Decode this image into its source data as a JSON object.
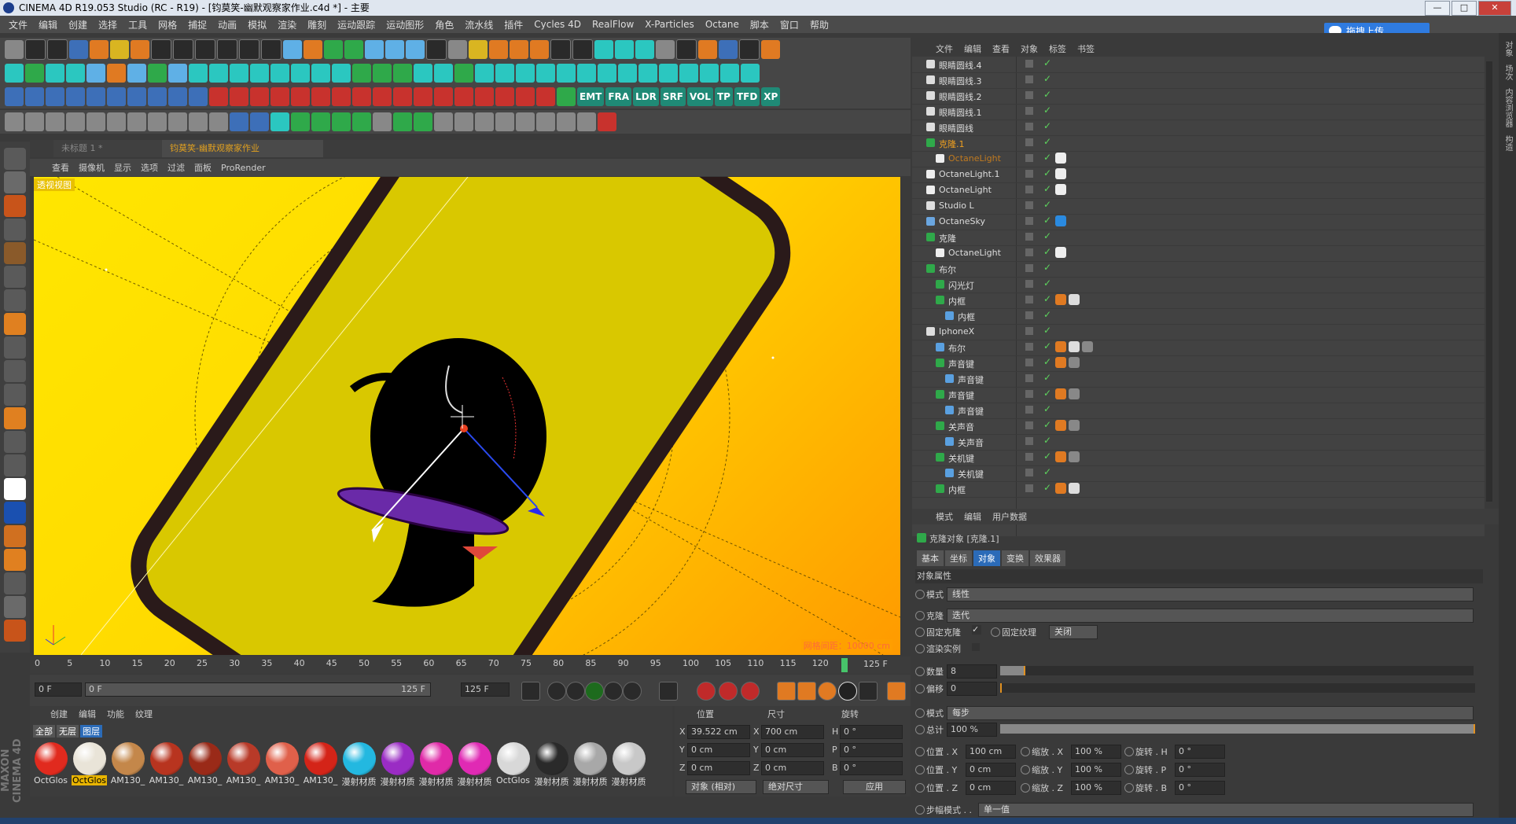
{
  "window": {
    "title": "CINEMA 4D R19.053 Studio (RC - R19) - [钧莫笑-幽默观察家作业.c4d *] - 主要",
    "min": "—",
    "max": "□",
    "close": "✕"
  },
  "menu": [
    "文件",
    "编辑",
    "创建",
    "选择",
    "工具",
    "网格",
    "捕捉",
    "动画",
    "模拟",
    "渲染",
    "雕刻",
    "运动跟踪",
    "运动图形",
    "角色",
    "流水线",
    "插件",
    "Cycles 4D",
    "RealFlow",
    "X-Particles",
    "Octane",
    "脚本",
    "窗口",
    "帮助"
  ],
  "upload_label": "拖拽上传",
  "toolbar": {
    "plugin_labels": [
      "EMT",
      "FRA",
      "LDR",
      "SRF",
      "VOL",
      "TP",
      "TFD",
      "XP"
    ]
  },
  "viewport": {
    "tabs": [
      "未标题 1 *",
      "钧莫笑-幽默观察家作业"
    ],
    "menu": [
      "查看",
      "摄像机",
      "显示",
      "选项",
      "过滤",
      "面板",
      "ProRender"
    ],
    "label": "透视视图",
    "grid_note": "网格间距：10000 cm",
    "axes": [
      "Y",
      "X",
      "Z"
    ]
  },
  "timeline": {
    "ticks": [
      "0",
      "5",
      "10",
      "15",
      "20",
      "25",
      "30",
      "35",
      "40",
      "45",
      "50",
      "55",
      "60",
      "65",
      "70",
      "75",
      "80",
      "85",
      "90",
      "95",
      "100",
      "105",
      "110",
      "115",
      "120"
    ],
    "end_frame": "125 F",
    "current_frame": "0 F",
    "range_start": "0 F",
    "range_end": "125 F",
    "range_end_2": "125 F",
    "playhead_frame": 125
  },
  "materials": {
    "menu": [
      "创建",
      "编辑",
      "功能",
      "纹理"
    ],
    "tabs": [
      "全部",
      "无层",
      "图层"
    ],
    "items": [
      {
        "name": "OctGlos",
        "color": "#e12a1e"
      },
      {
        "name": "OctGlos",
        "color": "#e9e4d8",
        "selected": true
      },
      {
        "name": "AM130_",
        "color": "#c4874a"
      },
      {
        "name": "AM130_",
        "color": "#b8341f"
      },
      {
        "name": "AM130_",
        "color": "#9a2a18"
      },
      {
        "name": "AM130_",
        "color": "#b83a28"
      },
      {
        "name": "AM130_",
        "color": "#e0604a"
      },
      {
        "name": "AM130_",
        "color": "#d42418"
      },
      {
        "name": "漫射材质",
        "color": "#23b8e0"
      },
      {
        "name": "漫射材质",
        "color": "#9a2cc4"
      },
      {
        "name": "漫射材质",
        "color": "#e02aa8"
      },
      {
        "name": "漫射材质",
        "color": "#e02ab4"
      },
      {
        "name": "OctGlos",
        "color": "#d8d8d8"
      },
      {
        "name": "漫射材质",
        "color": "#2a2a2a"
      },
      {
        "name": "漫射材质",
        "color": "#a8a8a8"
      },
      {
        "name": "漫射材质",
        "color": "#c8c8c8"
      }
    ]
  },
  "coords": {
    "headers": [
      "位置",
      "尺寸",
      "旋转"
    ],
    "rows": [
      {
        "axis": "X",
        "pos": "39.522 cm",
        "sizeaxis": "X",
        "size": "700 cm",
        "rotaxis": "H",
        "rot": "0 °"
      },
      {
        "axis": "Y",
        "pos": "0 cm",
        "sizeaxis": "Y",
        "size": "0 cm",
        "rotaxis": "P",
        "rot": "0 °"
      },
      {
        "axis": "Z",
        "pos": "0 cm",
        "sizeaxis": "Z",
        "size": "0 cm",
        "rotaxis": "B",
        "rot": "0 °"
      }
    ],
    "mode": "对象 (相对)",
    "size_mode": "绝对尺寸",
    "apply": "应用"
  },
  "object_manager": {
    "menu": [
      "文件",
      "编辑",
      "查看",
      "对象",
      "标签",
      "书签"
    ],
    "rows": [
      {
        "name": "眼睛圆线.4",
        "indent": 0,
        "icon": "null",
        "tags": []
      },
      {
        "name": "眼睛圆线.3",
        "indent": 0,
        "icon": "null",
        "tags": []
      },
      {
        "name": "眼睛圆线.2",
        "indent": 0,
        "icon": "null",
        "tags": []
      },
      {
        "name": "眼睛圆线.1",
        "indent": 0,
        "icon": "null",
        "tags": []
      },
      {
        "name": "眼睛圆线",
        "indent": 0,
        "icon": "null",
        "tags": []
      },
      {
        "name": "克隆.1",
        "indent": 0,
        "icon": "cloner",
        "style": "hl",
        "tags": []
      },
      {
        "name": "OctaneLight",
        "indent": 1,
        "icon": "light",
        "style": "dim",
        "tags": [
          "light"
        ]
      },
      {
        "name": "OctaneLight.1",
        "indent": 0,
        "icon": "light",
        "tags": [
          "light"
        ]
      },
      {
        "name": "OctaneLight",
        "indent": 0,
        "icon": "light",
        "tags": [
          "light"
        ]
      },
      {
        "name": "Studio L",
        "indent": 0,
        "icon": "null",
        "tags": []
      },
      {
        "name": "OctaneSky",
        "indent": 0,
        "icon": "sky",
        "tags": [
          "sky"
        ]
      },
      {
        "name": "克隆",
        "indent": 0,
        "icon": "cloner",
        "tags": []
      },
      {
        "name": "OctaneLight",
        "indent": 1,
        "icon": "light",
        "tags": [
          "light"
        ]
      },
      {
        "name": "布尔",
        "indent": 0,
        "icon": "boole",
        "tags": []
      },
      {
        "name": "闪光灯",
        "indent": 1,
        "icon": "cloner",
        "tags": []
      },
      {
        "name": "内框",
        "indent": 1,
        "icon": "extrude",
        "tags": [
          "mat",
          "check"
        ]
      },
      {
        "name": "内框",
        "indent": 2,
        "icon": "spline",
        "tags": []
      },
      {
        "name": "IphoneX",
        "indent": 0,
        "icon": "null",
        "tags": []
      },
      {
        "name": "布尔",
        "indent": 1,
        "icon": "boole2",
        "tags": [
          "mat",
          "check",
          "sphere"
        ]
      },
      {
        "name": "声音键",
        "indent": 1,
        "icon": "extrude",
        "tags": [
          "mat",
          "sphere"
        ]
      },
      {
        "name": "声音键",
        "indent": 2,
        "icon": "spline",
        "tags": []
      },
      {
        "name": "声音键",
        "indent": 1,
        "icon": "extrude",
        "tags": [
          "mat",
          "sphere"
        ]
      },
      {
        "name": "声音键",
        "indent": 2,
        "icon": "spline",
        "tags": []
      },
      {
        "name": "关声音",
        "indent": 1,
        "icon": "extrude",
        "tags": [
          "mat",
          "sphere"
        ]
      },
      {
        "name": "关声音",
        "indent": 2,
        "icon": "spline",
        "tags": []
      },
      {
        "name": "关机键",
        "indent": 1,
        "icon": "extrude",
        "tags": [
          "mat",
          "sphere"
        ]
      },
      {
        "name": "关机键",
        "indent": 2,
        "icon": "spline",
        "tags": []
      },
      {
        "name": "内框",
        "indent": 1,
        "icon": "extrude",
        "tags": [
          "mat",
          "check"
        ]
      }
    ]
  },
  "attributes": {
    "menu": [
      "模式",
      "编辑",
      "用户数据"
    ],
    "title": "克隆对象 [克隆.1]",
    "tabs": [
      "基本",
      "坐标",
      "对象",
      "变换",
      "效果器"
    ],
    "selected_tab": "对象",
    "section": "对象属性",
    "mode_label": "模式",
    "mode_value": "线性",
    "clone_label": "克隆",
    "clone_value": "迭代",
    "fix_clone": "固定克隆",
    "fix_clone_check": "✓",
    "fix_texture": "固定纹理",
    "fix_texture_value": "关闭",
    "render_instances": "渲染实例",
    "count_label": "数量",
    "count_value": "8",
    "count_fill": 0.05,
    "offset_label": "偏移",
    "offset_value": "0",
    "mode2_label": "模式",
    "mode2_value": "每步",
    "total_label": "总计",
    "total_value": "100 %",
    "total_fill": 1.0,
    "transform_rows": [
      {
        "pos_label": "位置 . X",
        "pos_value": "100 cm",
        "scale_label": "缩放 . X",
        "scale_value": "100 %",
        "rot_label": "旋转 . H",
        "rot_value": "0 °"
      },
      {
        "pos_label": "位置 . Y",
        "pos_value": "0 cm",
        "scale_label": "缩放 . Y",
        "scale_value": "100 %",
        "rot_label": "旋转 . P",
        "rot_value": "0 °"
      },
      {
        "pos_label": "位置 . Z",
        "pos_value": "0 cm",
        "scale_label": "缩放 . Z",
        "scale_value": "100 %",
        "rot_label": "旋转 . B",
        "rot_value": "0 °"
      }
    ],
    "step_mode_label": "步幅模式 . .",
    "step_mode_value": "单一值"
  },
  "side_strip": [
    "对象",
    "场次",
    "内容浏览器",
    "构造"
  ],
  "maxon": "MAXON CINEMA 4D",
  "colors": {
    "accent": "#2b6bb8",
    "highlight": "#f0a020",
    "viewport_yellow": "#ffdc00"
  }
}
